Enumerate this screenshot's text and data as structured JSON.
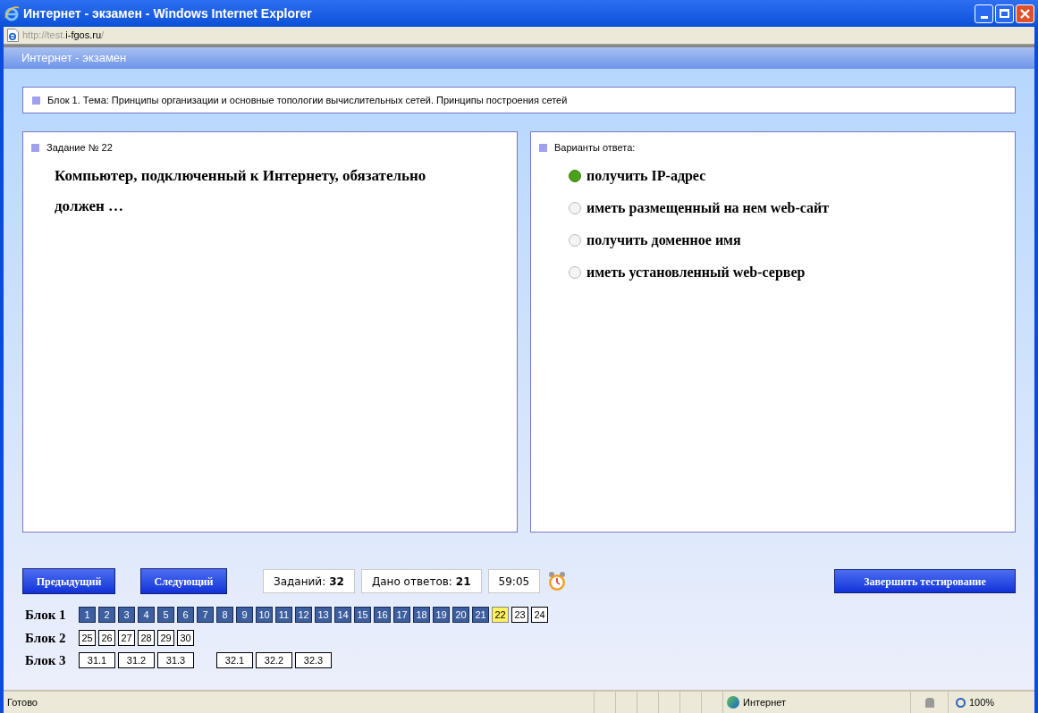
{
  "window": {
    "title": "Интернет - экзамен - Windows Internet Explorer"
  },
  "address": {
    "prefix": "http://test.",
    "domain": "i-fgos.ru",
    "suffix": "/"
  },
  "header": {
    "title": "Интернет - экзамен"
  },
  "topic": "Блок 1. Тема: Принципы организации и основные топологии вычислительных сетей. Принципы построения сетей",
  "task": {
    "label": "Задание № 22",
    "text": "Компьютер, подключенный к Интернету, обязательно должен …"
  },
  "answers": {
    "label": "Варианты ответа:",
    "options": [
      {
        "text": "получить IP-адрес",
        "selected": true
      },
      {
        "text": "иметь размещенный на нем web-сайт",
        "selected": false
      },
      {
        "text": "получить доменное имя",
        "selected": false
      },
      {
        "text": "иметь установленный web-сервер",
        "selected": false
      }
    ]
  },
  "buttons": {
    "prev": "Предыдущий",
    "next": "Следующий",
    "finish": "Завершить тестирование"
  },
  "stats": [
    {
      "label": "Заданий:",
      "value": "32"
    },
    {
      "label": "Дано ответов:",
      "value": "21"
    },
    {
      "value": "59:05"
    }
  ],
  "blocks": [
    {
      "name": "Блок 1",
      "kind": "numbers",
      "items": [
        {
          "label": "1",
          "answered": true,
          "selected": false
        },
        {
          "label": "2",
          "answered": true,
          "selected": false
        },
        {
          "label": "3",
          "answered": true,
          "selected": false
        },
        {
          "label": "4",
          "answered": true,
          "selected": false
        },
        {
          "label": "5",
          "answered": true,
          "selected": false
        },
        {
          "label": "6",
          "answered": true,
          "selected": false
        },
        {
          "label": "7",
          "answered": true,
          "selected": false
        },
        {
          "label": "8",
          "answered": true,
          "selected": false
        },
        {
          "label": "9",
          "answered": true,
          "selected": false
        },
        {
          "label": "10",
          "answered": true,
          "selected": false
        },
        {
          "label": "11",
          "answered": true,
          "selected": false
        },
        {
          "label": "12",
          "answered": true,
          "selected": false
        },
        {
          "label": "13",
          "answered": true,
          "selected": false
        },
        {
          "label": "14",
          "answered": true,
          "selected": false
        },
        {
          "label": "15",
          "answered": true,
          "selected": false
        },
        {
          "label": "16",
          "answered": true,
          "selected": false
        },
        {
          "label": "17",
          "answered": true,
          "selected": false
        },
        {
          "label": "18",
          "answered": true,
          "selected": false
        },
        {
          "label": "19",
          "answered": true,
          "selected": false
        },
        {
          "label": "20",
          "answered": true,
          "selected": false
        },
        {
          "label": "21",
          "answered": true,
          "selected": false
        },
        {
          "label": "22",
          "answered": false,
          "selected": true
        },
        {
          "label": "23",
          "answered": false,
          "selected": false
        },
        {
          "label": "24",
          "answered": false,
          "selected": false
        }
      ]
    },
    {
      "name": "Блок 2",
      "kind": "numbers",
      "items": [
        {
          "label": "25",
          "answered": false,
          "selected": false
        },
        {
          "label": "26",
          "answered": false,
          "selected": false
        },
        {
          "label": "27",
          "answered": false,
          "selected": false
        },
        {
          "label": "28",
          "answered": false,
          "selected": false
        },
        {
          "label": "29",
          "answered": false,
          "selected": false
        },
        {
          "label": "30",
          "answered": false,
          "selected": false
        }
      ]
    },
    {
      "name": "Блок 3",
      "kind": "subtasks",
      "groups": [
        [
          {
            "label": "31.1",
            "answered": false,
            "selected": false
          },
          {
            "label": "31.2",
            "answered": false,
            "selected": false
          },
          {
            "label": "31.3",
            "answered": false,
            "selected": false
          }
        ],
        [
          {
            "label": "32.1",
            "answered": false,
            "selected": false
          },
          {
            "label": "32.2",
            "answered": false,
            "selected": false
          },
          {
            "label": "32.3",
            "answered": false,
            "selected": false
          }
        ]
      ]
    }
  ],
  "status_bar": {
    "text": "Готово",
    "zone": "Интернет",
    "zoom": "100%"
  }
}
